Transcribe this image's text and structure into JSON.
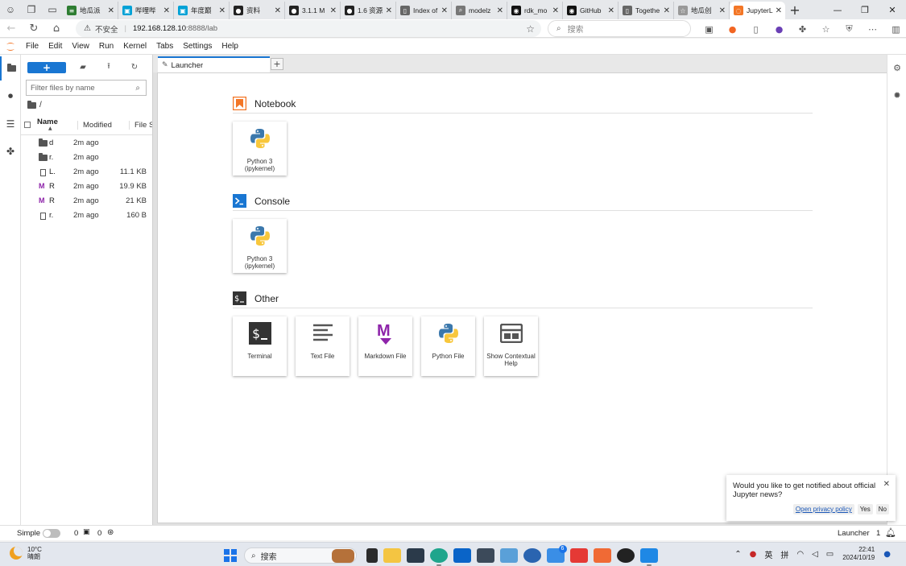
{
  "browser": {
    "tabs": [
      {
        "title": "地瓜派",
        "color": "#2e7d32",
        "glyph": "≡"
      },
      {
        "title": "哔哩哔",
        "color": "#00a1d6",
        "glyph": "▣"
      },
      {
        "title": "年度巅",
        "color": "#00a1d6",
        "glyph": "▣"
      },
      {
        "title": "资料",
        "color": "#222222",
        "glyph": "●"
      },
      {
        "title": "3.1.1 M",
        "color": "#222222",
        "glyph": "●"
      },
      {
        "title": "1.6 资源",
        "color": "#222222",
        "glyph": "●"
      },
      {
        "title": "Index of",
        "color": "#666666",
        "glyph": "▯"
      },
      {
        "title": "modelz",
        "color": "#777777",
        "glyph": "⌕"
      },
      {
        "title": "rdk_mo",
        "color": "#111111",
        "glyph": "◉"
      },
      {
        "title": "GitHub",
        "color": "#111111",
        "glyph": "◉"
      },
      {
        "title": "Togethe",
        "color": "#666666",
        "glyph": "▯"
      },
      {
        "title": "地瓜创",
        "color": "#999999",
        "glyph": "☆"
      },
      {
        "title": "JupyterL",
        "color": "#f37626",
        "glyph": "◌"
      }
    ],
    "url_security": "不安全",
    "url_host": "192.168.128.10",
    "url_path": ":8888/lab",
    "search_placeholder": "搜索"
  },
  "menubar": {
    "items": [
      "File",
      "Edit",
      "View",
      "Run",
      "Kernel",
      "Tabs",
      "Settings",
      "Help"
    ]
  },
  "filebrowser": {
    "new_label": "+",
    "filter_placeholder": "Filter files by name",
    "path": "/",
    "col_name": "Name",
    "col_modified": "Modified",
    "col_size": "File Size",
    "files": [
      {
        "name": "d",
        "type": "folder",
        "modified": "2m ago",
        "size": ""
      },
      {
        "name": "r.",
        "type": "folder",
        "modified": "2m ago",
        "size": ""
      },
      {
        "name": "L.",
        "type": "file",
        "modified": "2m ago",
        "size": "11.1 KB"
      },
      {
        "name": "R",
        "type": "markdown",
        "modified": "2m ago",
        "size": "19.9 KB"
      },
      {
        "name": "R",
        "type": "markdown",
        "modified": "2m ago",
        "size": "21 KB"
      },
      {
        "name": "r.",
        "type": "file",
        "modified": "2m ago",
        "size": "160 B"
      }
    ]
  },
  "launcher": {
    "tab_label": "Launcher",
    "add_tab": "+",
    "sections": {
      "notebook": {
        "title": "Notebook",
        "card": "Python 3 (ipykernel)"
      },
      "console": {
        "title": "Console",
        "card": "Python 3 (ipykernel)"
      },
      "other": {
        "title": "Other",
        "cards": [
          "Terminal",
          "Text File",
          "Markdown File",
          "Python File",
          "Show Contextual Help"
        ]
      }
    }
  },
  "notification": {
    "message": "Would you like to get notified about official Jupyter news?",
    "privacy": "Open privacy policy",
    "yes": "Yes",
    "no": "No"
  },
  "statusbar": {
    "mode": "Simple",
    "terminals": "0",
    "kernels": "0",
    "activity": "Launcher",
    "notifications": "1"
  },
  "taskbar": {
    "temperature": "10°C",
    "weather": "晴朗",
    "search": "搜索",
    "ime_lang": "英",
    "ime_mode": "拼",
    "time": "22:41",
    "date": "2024/10/19",
    "badge": "6"
  },
  "colors": {
    "accent": "#1976d2",
    "jupyter_orange": "#f37626",
    "markdown_purple": "#8e24aa"
  }
}
